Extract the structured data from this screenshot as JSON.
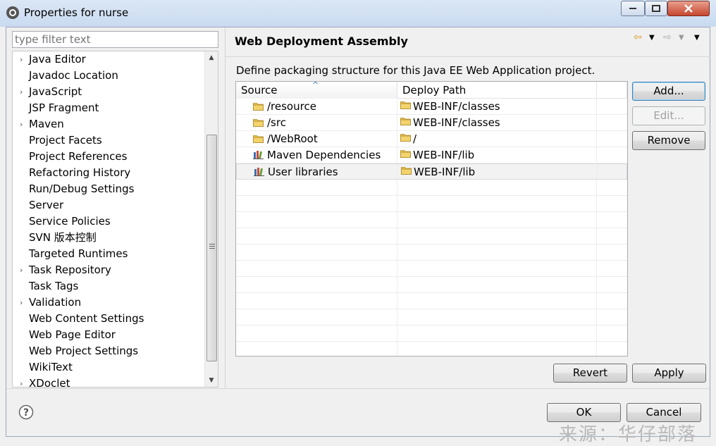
{
  "window": {
    "title": "Properties for nurse"
  },
  "filter": {
    "placeholder": "type filter text"
  },
  "tree": {
    "items": [
      {
        "label": "Java Editor",
        "expandable": true
      },
      {
        "label": "Javadoc Location",
        "expandable": false
      },
      {
        "label": "JavaScript",
        "expandable": true
      },
      {
        "label": "JSP Fragment",
        "expandable": false
      },
      {
        "label": "Maven",
        "expandable": true
      },
      {
        "label": "Project Facets",
        "expandable": false
      },
      {
        "label": "Project References",
        "expandable": false
      },
      {
        "label": "Refactoring History",
        "expandable": false
      },
      {
        "label": "Run/Debug Settings",
        "expandable": false
      },
      {
        "label": "Server",
        "expandable": false
      },
      {
        "label": "Service Policies",
        "expandable": false
      },
      {
        "label": "SVN 版本控制",
        "expandable": false
      },
      {
        "label": "Targeted Runtimes",
        "expandable": false
      },
      {
        "label": "Task Repository",
        "expandable": true
      },
      {
        "label": "Task Tags",
        "expandable": false
      },
      {
        "label": "Validation",
        "expandable": true
      },
      {
        "label": "Web Content Settings",
        "expandable": false
      },
      {
        "label": "Web Page Editor",
        "expandable": false
      },
      {
        "label": "Web Project Settings",
        "expandable": false
      },
      {
        "label": "WikiText",
        "expandable": false
      },
      {
        "label": "XDoclet",
        "expandable": true
      }
    ]
  },
  "page": {
    "title": "Web Deployment Assembly",
    "description": "Define packaging structure for this Java EE Web Application project."
  },
  "table": {
    "columns": [
      "Source",
      "Deploy Path"
    ],
    "rows": [
      {
        "source": "/resource",
        "source_icon": "folder-icon",
        "deploy": "WEB-INF/classes"
      },
      {
        "source": "/src",
        "source_icon": "folder-icon",
        "deploy": "WEB-INF/classes"
      },
      {
        "source": "/WebRoot",
        "source_icon": "folder-icon",
        "deploy": "/"
      },
      {
        "source": "Maven Dependencies",
        "source_icon": "library-icon",
        "deploy": "WEB-INF/lib"
      },
      {
        "source": "User libraries",
        "source_icon": "library-icon",
        "deploy": "WEB-INF/lib",
        "selected": true
      }
    ]
  },
  "buttons": {
    "add": "Add...",
    "edit": "Edit...",
    "remove": "Remove",
    "revert": "Revert",
    "apply": "Apply",
    "ok": "OK",
    "cancel": "Cancel"
  },
  "watermark": "来源：华仔部落",
  "colors": {
    "folder": "#e8c04a",
    "accent": "#3c7fb1",
    "close_button": "#c7452e"
  }
}
